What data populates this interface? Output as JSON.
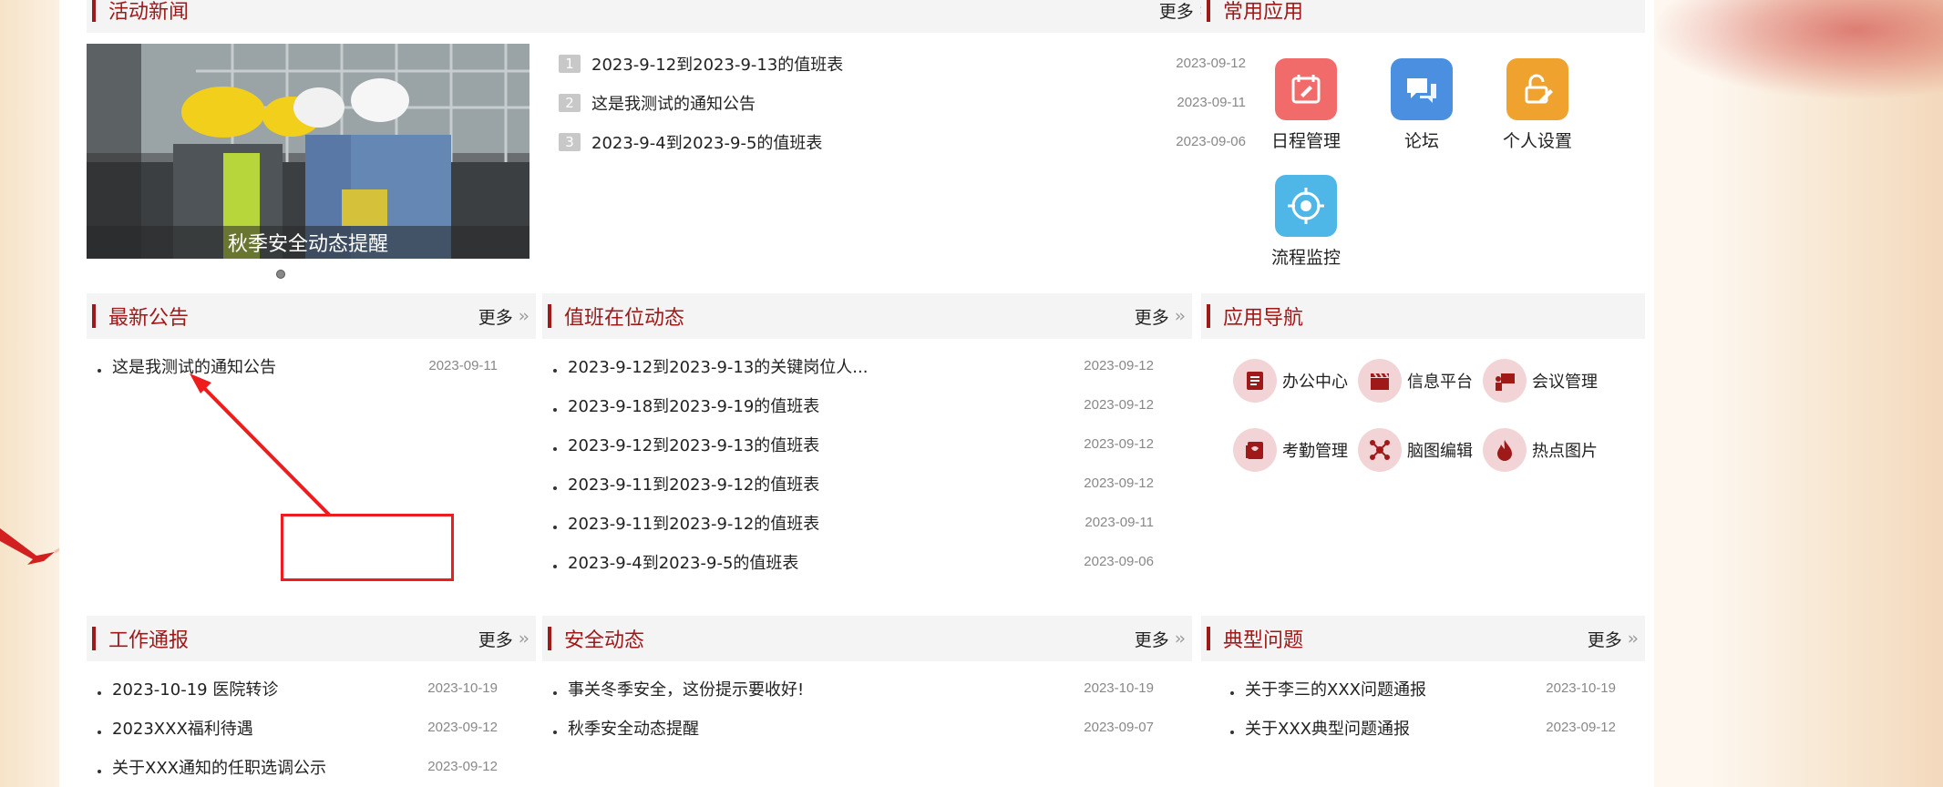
{
  "activity_news": {
    "title": "活动新闻",
    "more": "更多",
    "carousel_caption": "秋季安全动态提醒",
    "items": [
      {
        "num": "1",
        "text": "2023-9-12到2023-9-13的值班表",
        "date": "2023-09-12"
      },
      {
        "num": "2",
        "text": "这是我测试的通知公告",
        "date": "2023-09-11"
      },
      {
        "num": "3",
        "text": "2023-9-4到2023-9-5的值班表",
        "date": "2023-09-06"
      }
    ]
  },
  "common_apps": {
    "title": "常用应用",
    "apps": [
      {
        "label": "日程管理",
        "icon": "calendar-icon",
        "color": "#f26b6b"
      },
      {
        "label": "论坛",
        "icon": "chat-bubbles-icon",
        "color": "#4a8fe0"
      },
      {
        "label": "个人设置",
        "icon": "lock-edit-icon",
        "color": "#f0a22e"
      },
      {
        "label": "流程监控",
        "icon": "target-icon",
        "color": "#4fb7e8"
      }
    ]
  },
  "latest_notice": {
    "title": "最新公告",
    "more": "更多",
    "items": [
      {
        "text": "这是我测试的通知公告",
        "date": "2023-09-11"
      }
    ]
  },
  "duty_status": {
    "title": "值班在位动态",
    "more": "更多",
    "items": [
      {
        "text": "2023-9-12到2023-9-13的关键岗位人...",
        "date": "2023-09-12"
      },
      {
        "text": "2023-9-18到2023-9-19的值班表",
        "date": "2023-09-12"
      },
      {
        "text": "2023-9-12到2023-9-13的值班表",
        "date": "2023-09-12"
      },
      {
        "text": "2023-9-11到2023-9-12的值班表",
        "date": "2023-09-12"
      },
      {
        "text": "2023-9-11到2023-9-12的值班表",
        "date": "2023-09-11"
      },
      {
        "text": "2023-9-4到2023-9-5的值班表",
        "date": "2023-09-06"
      }
    ]
  },
  "app_nav": {
    "title": "应用导航",
    "items": [
      {
        "label": "办公中心",
        "icon": "office-icon"
      },
      {
        "label": "信息平台",
        "icon": "clapper-icon"
      },
      {
        "label": "会议管理",
        "icon": "presentation-icon"
      },
      {
        "label": "考勤管理",
        "icon": "attendance-icon"
      },
      {
        "label": "脑图编辑",
        "icon": "mindmap-icon"
      },
      {
        "label": "热点图片",
        "icon": "flame-icon"
      }
    ]
  },
  "work_report": {
    "title": "工作通报",
    "more": "更多",
    "items": [
      {
        "text": "2023-10-19 医院转诊",
        "date": "2023-10-19"
      },
      {
        "text": "2023XXX福利待遇",
        "date": "2023-09-12"
      },
      {
        "text": "关于XXX通知的任职选调公示",
        "date": "2023-09-12"
      }
    ]
  },
  "safety_news": {
    "title": "安全动态",
    "more": "更多",
    "items": [
      {
        "text": "事关冬季安全，这份提示要收好!",
        "date": "2023-10-19"
      },
      {
        "text": "秋季安全动态提醒",
        "date": "2023-09-07"
      }
    ]
  },
  "typical_issues": {
    "title": "典型问题",
    "more": "更多",
    "items": [
      {
        "text": "关于李三的XXX问题通报",
        "date": "2023-10-19"
      },
      {
        "text": "关于XXX典型问题通报",
        "date": "2023-09-12"
      }
    ]
  },
  "colors": {
    "accent": "#a01919",
    "annotation": "#ee1c1c"
  }
}
